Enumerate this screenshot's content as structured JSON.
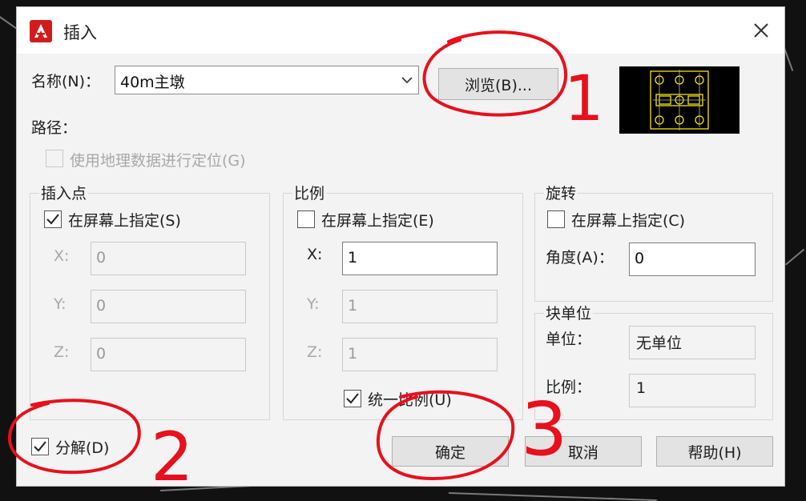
{
  "window": {
    "title": "插入",
    "app_icon": "autocad-icon",
    "close_icon": "close-icon"
  },
  "name": {
    "label": "名称(N)：",
    "value": "40m主墩",
    "browse_label": "浏览(B)..."
  },
  "path_label": "路径：",
  "geo_checkbox": {
    "label": "使用地理数据进行定位(G)",
    "checked": false,
    "enabled": false
  },
  "insertion_point": {
    "title": "插入点",
    "specify_label": "在屏幕上指定(S)",
    "specify_checked": true,
    "x_label": "X:",
    "x_value": "0",
    "y_label": "Y:",
    "y_value": "0",
    "z_label": "Z:",
    "z_value": "0"
  },
  "scale": {
    "title": "比例",
    "specify_label": "在屏幕上指定(E)",
    "specify_checked": false,
    "x_label": "X:",
    "x_value": "1",
    "y_label": "Y:",
    "y_value": "1",
    "z_label": "Z:",
    "z_value": "1",
    "uniform_label": "统一比例(U)",
    "uniform_checked": true
  },
  "rotation": {
    "title": "旋转",
    "specify_label": "在屏幕上指定(C)",
    "specify_checked": false,
    "angle_label": "角度(A)：",
    "angle_value": "0"
  },
  "block_unit": {
    "title": "块单位",
    "unit_label": "单位：",
    "unit_value": "无单位",
    "factor_label": "比例：",
    "factor_value": "1"
  },
  "explode": {
    "label": "分解(D)",
    "checked": true
  },
  "buttons": {
    "ok": "确定",
    "cancel": "取消",
    "help": "帮助(H)"
  },
  "annotations": {
    "one": "1",
    "two": "2",
    "three": "3",
    "color": "#e8101c"
  },
  "colors": {
    "preview_stroke": "#f5e60a",
    "icon_red": "#d01c1c"
  }
}
